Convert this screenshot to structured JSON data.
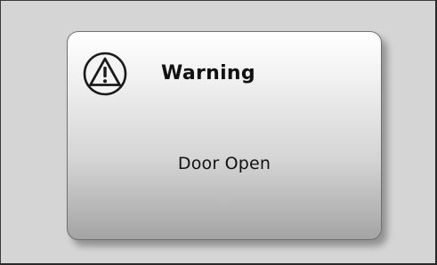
{
  "dialog": {
    "title": "Warning",
    "message": "Door Open",
    "icon": "warning-icon"
  }
}
